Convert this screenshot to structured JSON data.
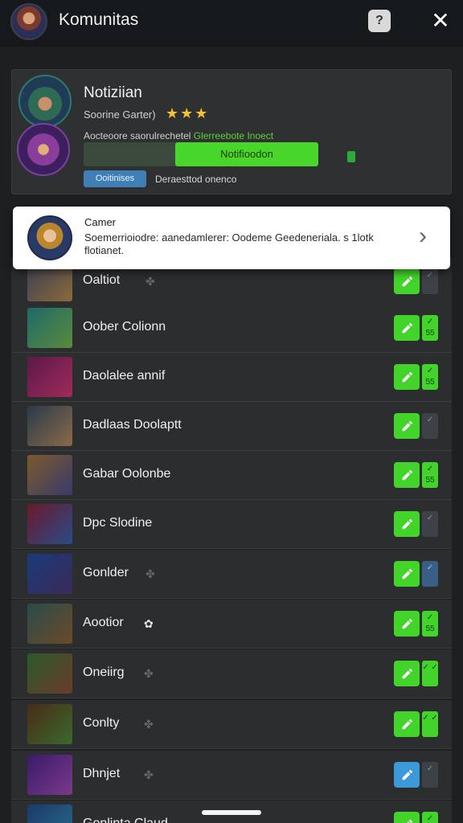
{
  "header": {
    "title": "Komunitas",
    "help_icon": "help-icon",
    "close_icon": "close-icon",
    "close_glyph": "✕",
    "help_glyph": "?"
  },
  "notification": {
    "title": "Notiziian",
    "subtitle": "Soorine Garter)",
    "stars": "★★★",
    "line_prefix": "Aocteoore saorulrechetel ",
    "line_green": "Glerreebote Inoect",
    "progress_label": "Notifioodon",
    "progress_fraction": 0.61,
    "tag": "Ooitinises",
    "tag_text": "Deraesttod onenco",
    "accent": "#48d62b"
  },
  "popup": {
    "title": "Camer",
    "text": "Soemerrioiodre: aanedamlerer: Oodeme Geedeneriala. s 1lotk flotianet.",
    "chevron": "›"
  },
  "rows": [
    {
      "label": "Oaltiot",
      "icon": "✤",
      "side": "gray",
      "side_text": "✓"
    },
    {
      "label": "Oober Colionn",
      "icon": "",
      "side": "green",
      "side_text": "✓ 55"
    },
    {
      "label": "Daolalee annif",
      "icon": "",
      "side": "green",
      "side_text": "✓ 55"
    },
    {
      "label": "Dadlaas Doolaptt",
      "icon": "",
      "side": "gray",
      "side_text": "✓"
    },
    {
      "label": "Gabar Oolonbe",
      "icon": "",
      "side": "green",
      "side_text": "✓ 55"
    },
    {
      "label": "Dpc Slodine",
      "icon": "",
      "side": "gray",
      "side_text": "✓"
    },
    {
      "label": "Gonlder",
      "icon": "✤",
      "side": "blue",
      "side_text": "✓"
    },
    {
      "label": "Aootior",
      "icon": "✿",
      "side": "green",
      "side_text": "✓ 55"
    },
    {
      "label": "Oneiirg",
      "icon": "✤",
      "side": "green",
      "side_text": "✓ ✓"
    },
    {
      "label": "Conlty",
      "icon": "✤",
      "side": "green",
      "side_text": "✓ ✓"
    },
    {
      "label": "Dhnjet",
      "icon": "✤",
      "side": "gray",
      "side_text": "✓",
      "btn": "blue"
    },
    {
      "label": "Gonlinta Claud",
      "icon": "",
      "side": "green",
      "side_text": "✓"
    }
  ]
}
